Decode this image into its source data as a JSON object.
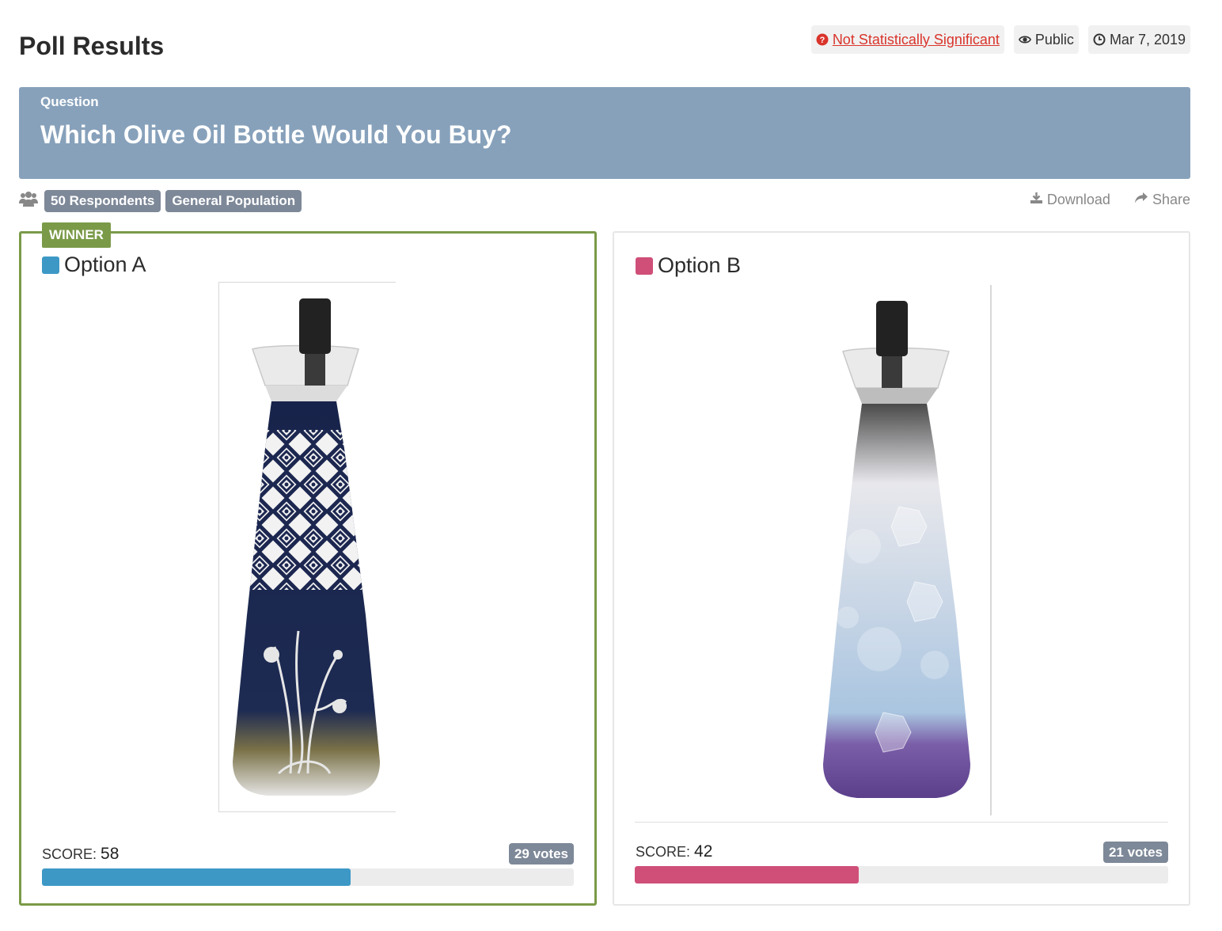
{
  "page": {
    "title": "Poll Results"
  },
  "status": {
    "significance": "Not Statistically Significant",
    "visibility": "Public",
    "date": "Mar 7, 2019"
  },
  "question": {
    "label": "Question",
    "text": "Which Olive Oil Bottle Would You Buy?"
  },
  "meta": {
    "respondents": "50 Respondents",
    "audience": "General Population"
  },
  "actions": {
    "download": "Download",
    "share": "Share"
  },
  "options": [
    {
      "name": "Option A",
      "winner_label": "WINNER",
      "score_label": "SCORE:",
      "score": "58",
      "votes": "29 votes",
      "percent": 58,
      "color": "#3d98c6"
    },
    {
      "name": "Option B",
      "score_label": "SCORE:",
      "score": "42",
      "votes": "21 votes",
      "percent": 42,
      "color": "#cf4f78"
    }
  ],
  "colors": {
    "winner": "#7a9a48",
    "panel": "#87a1bb",
    "badge": "#7d8898",
    "danger": "#d9342b"
  }
}
